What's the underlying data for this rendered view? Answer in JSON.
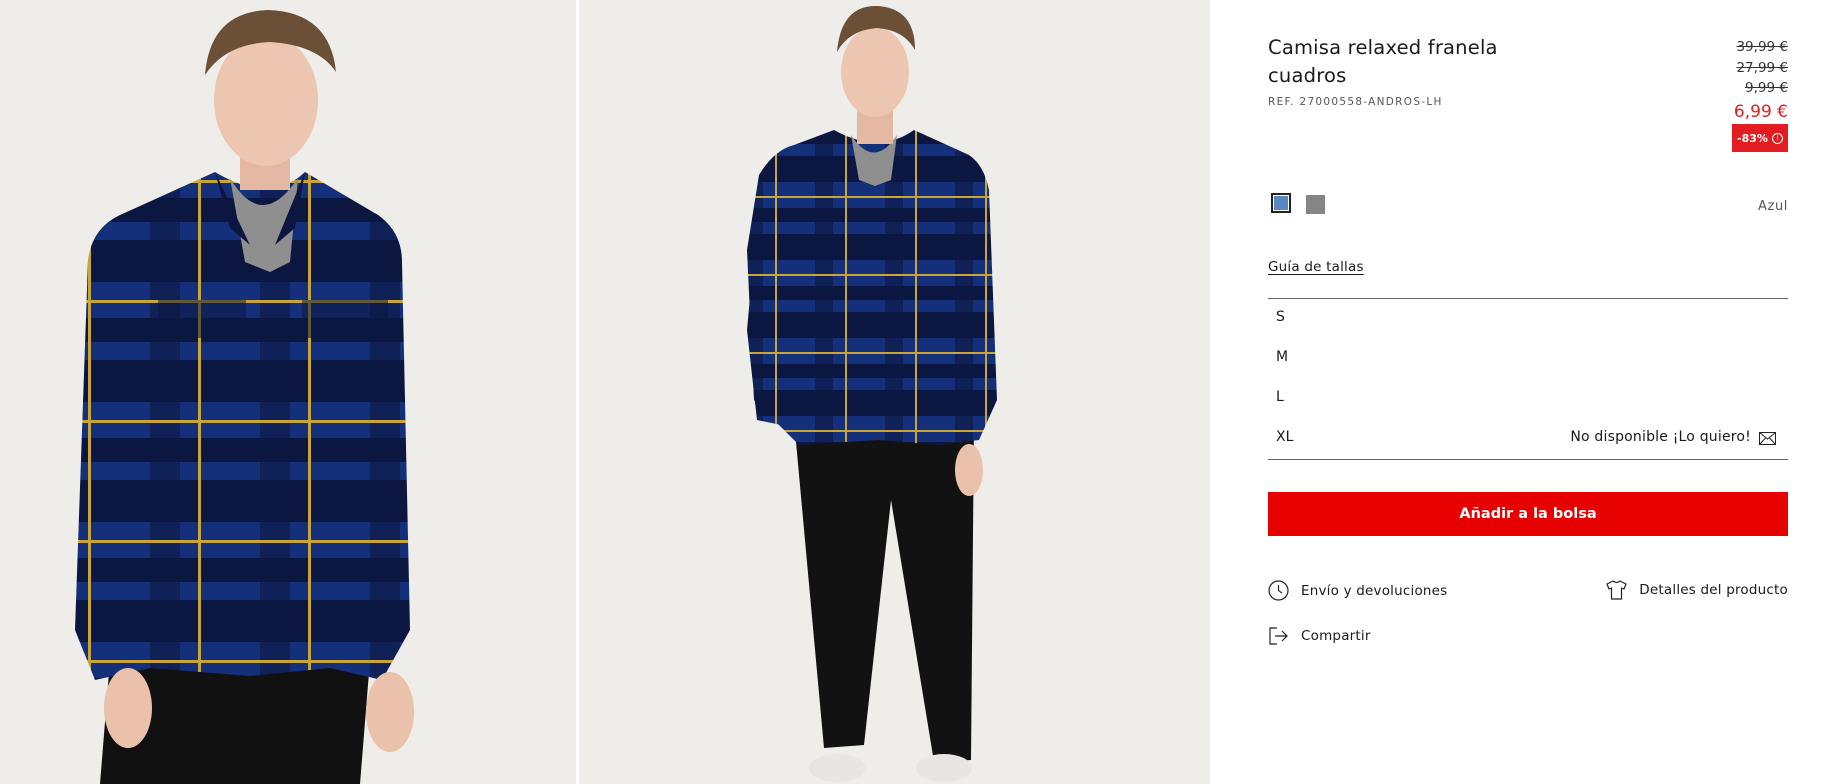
{
  "product": {
    "title": "Camisa relaxed franela cuadros",
    "ref": "REF. 27000558-ANDROS-LH",
    "prices": {
      "old": [
        "39,99 €",
        "27,99 €",
        "9,99 €"
      ],
      "current": "6,99 €"
    },
    "discount_badge": "-83%",
    "colors": [
      {
        "name": "Azul",
        "hex": "#5a87c2",
        "selected": true
      },
      {
        "name": "Gris",
        "hex": "#858585",
        "selected": false
      }
    ],
    "selected_color_label": "Azul"
  },
  "sizes": {
    "guide_label": "Guía de tallas",
    "items": [
      {
        "label": "S",
        "status": ""
      },
      {
        "label": "M",
        "status": ""
      },
      {
        "label": "L",
        "status": ""
      },
      {
        "label": "XL",
        "status": "No disponible ¡Lo quiero!"
      }
    ]
  },
  "actions": {
    "add_to_bag": "Añadir a la bolsa",
    "shipping": "Envío y devoluciones",
    "details": "Detalles del producto",
    "share": "Compartir"
  },
  "colors": {
    "accent_red": "#e60000",
    "price_red": "#e21c21"
  },
  "icons": [
    "clock-icon",
    "shirt-icon",
    "share-icon",
    "mail-icon",
    "info-icon"
  ]
}
